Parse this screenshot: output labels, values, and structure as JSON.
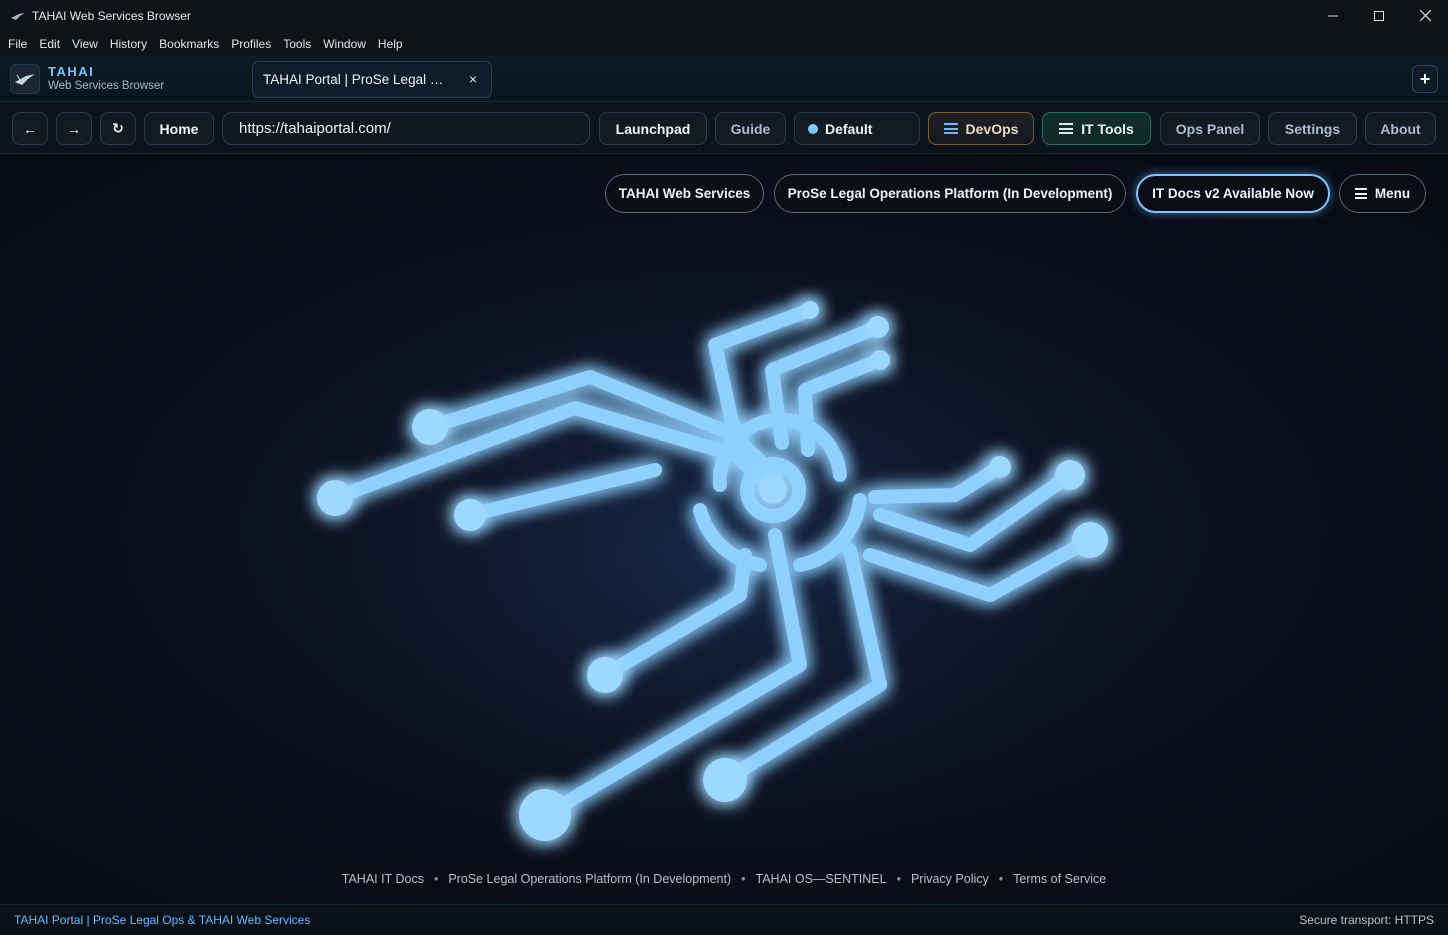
{
  "window": {
    "title": "TAHAI Web Services Browser"
  },
  "menu": [
    "File",
    "Edit",
    "View",
    "History",
    "Bookmarks",
    "Profiles",
    "Tools",
    "Window",
    "Help"
  ],
  "brand": {
    "name": "TAHAI",
    "subtitle": "Web Services Browser"
  },
  "tab": {
    "title": "TAHAI Portal | ProSe Legal Operations Platform",
    "close": "×"
  },
  "newtab": "+",
  "nav": {
    "back": "←",
    "forward": "→",
    "reload": "↻",
    "home": "Home",
    "url": "https://tahaiportal.com/",
    "launchpad": "Launchpad",
    "guide": "Guide",
    "profile": "Default",
    "devops": "DevOps",
    "it_tools": "IT Tools",
    "ops_panel": "Ops Panel",
    "settings": "Settings",
    "about": "About"
  },
  "page": {
    "nav_pills": {
      "web_services": "TAHAI Web Services",
      "prose": "ProSe Legal Operations Platform (In Development)",
      "it_docs": "IT Docs v2 Available Now",
      "menu": "Menu"
    },
    "footer": {
      "links": [
        "TAHAI IT Docs",
        "ProSe Legal Operations Platform (In Development)",
        "TAHAI OS—SENTINEL",
        "Privacy Policy",
        "Terms of Service"
      ],
      "separator": "•"
    }
  },
  "status": {
    "left": "TAHAI Portal | ProSe Legal Ops & TAHAI Web Services",
    "right": "Secure transport: HTTPS"
  },
  "colors": {
    "accent": "#5fb8ff",
    "glow": "#4aa8ff",
    "background": "#0b0f1c"
  },
  "icons": {
    "app": "tahai-bird-icon",
    "hero": "circuit-x-logo"
  }
}
